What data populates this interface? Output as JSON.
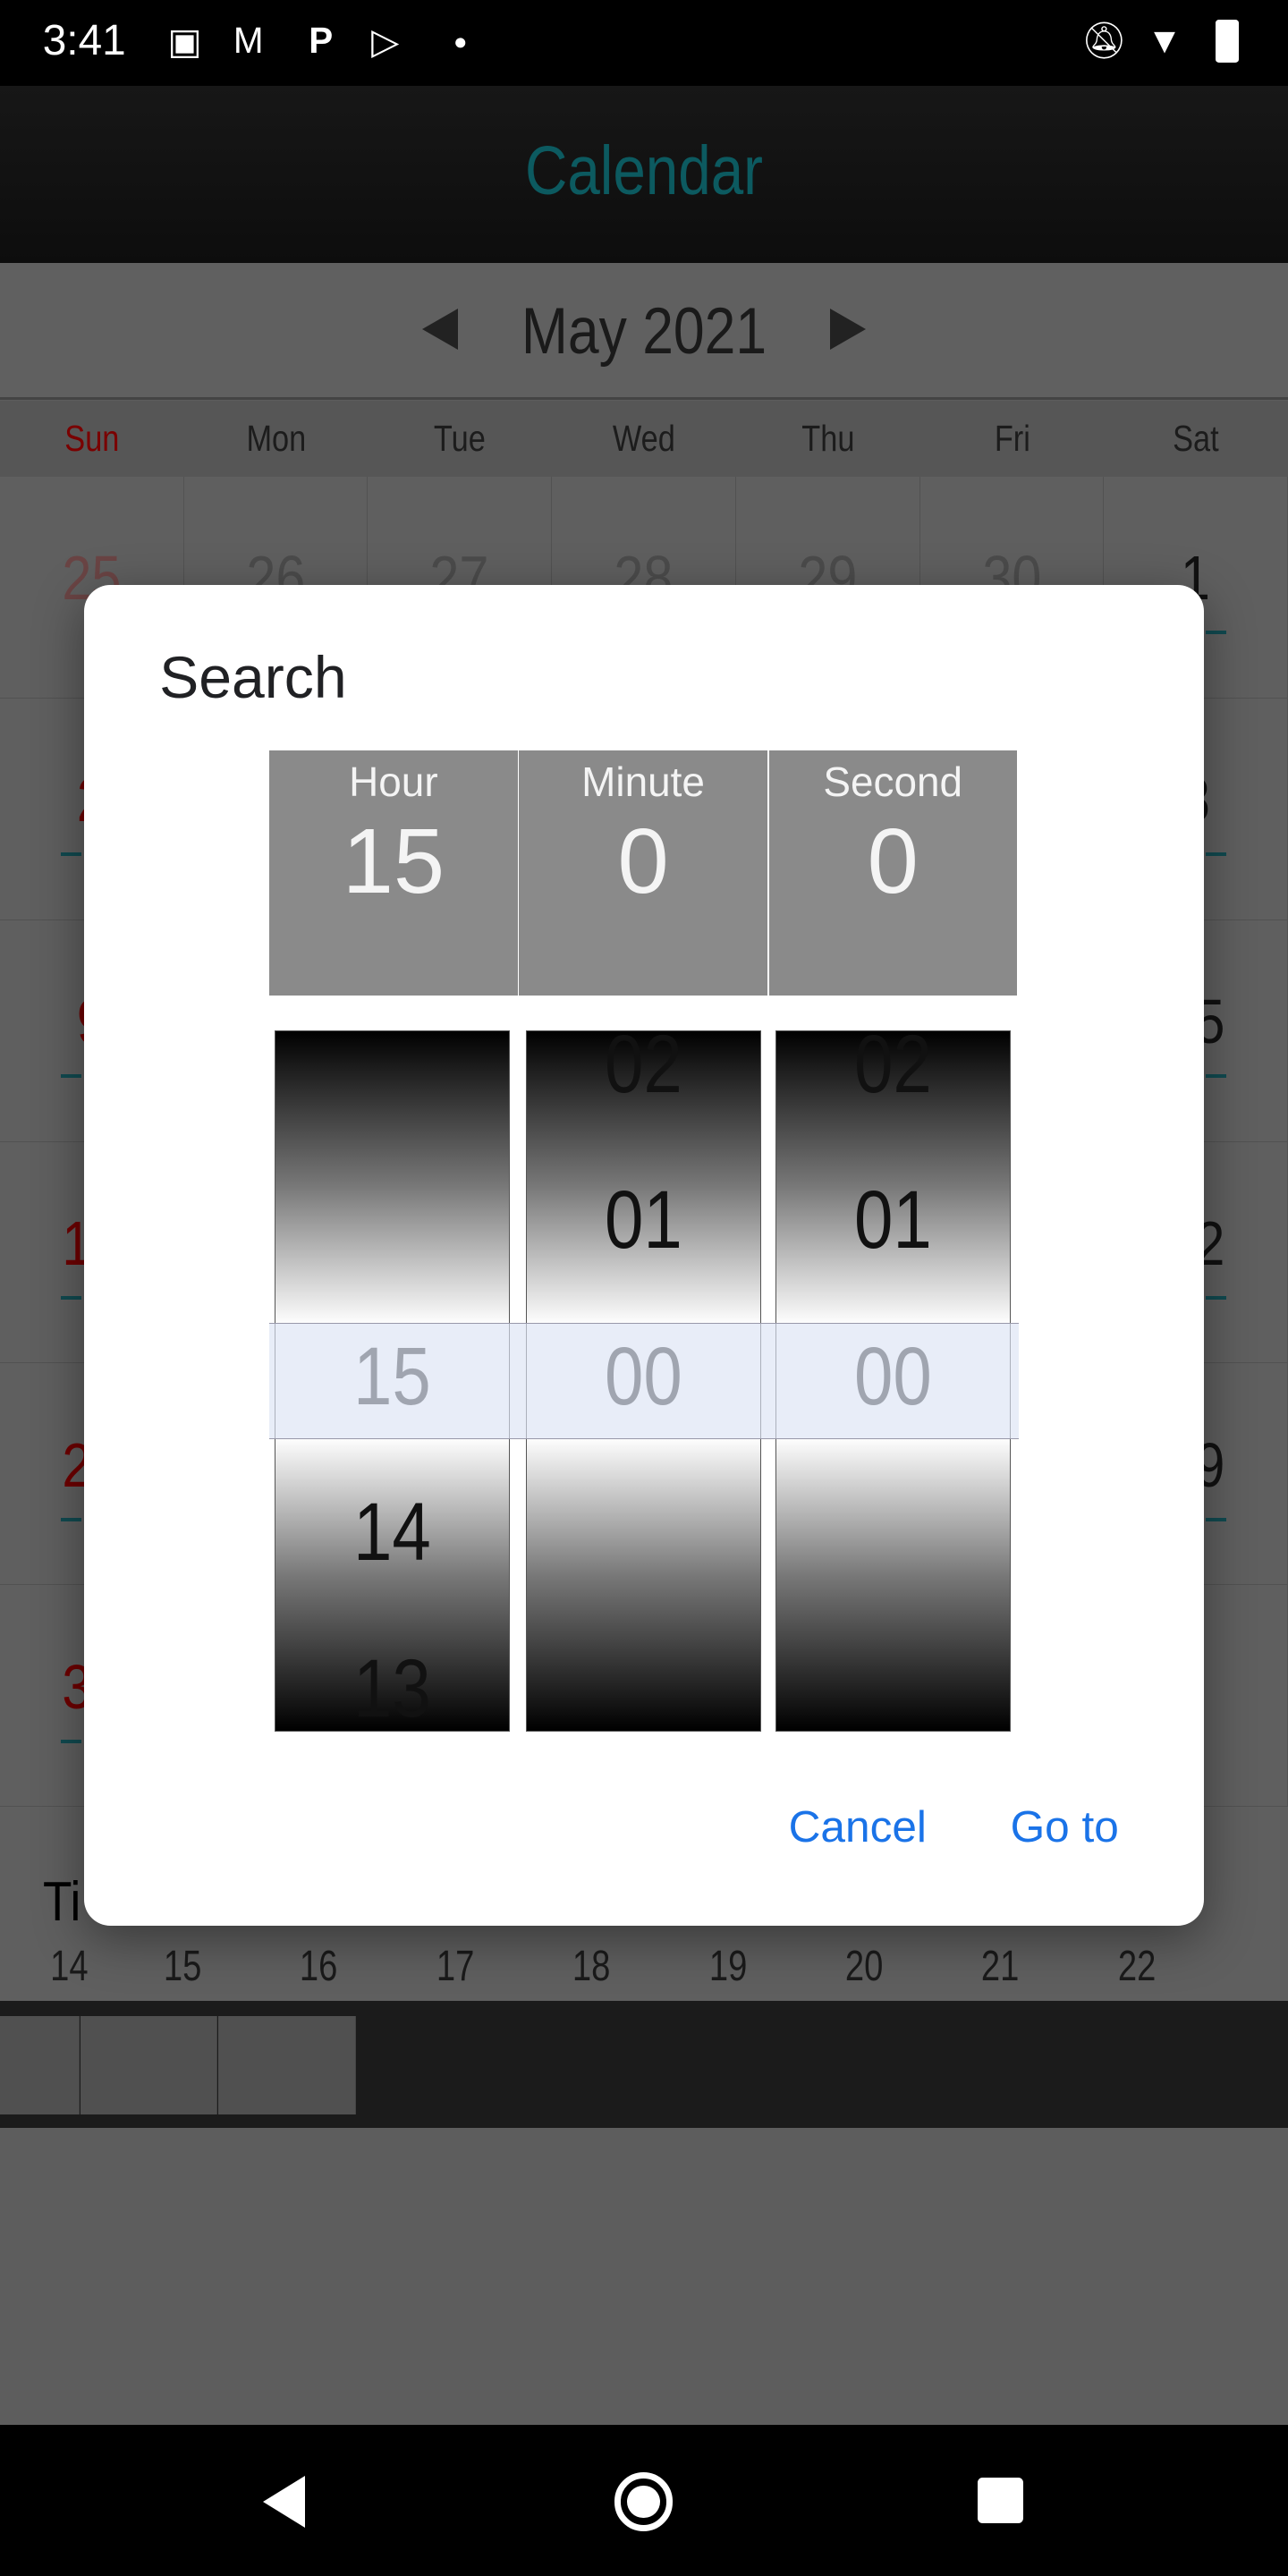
{
  "status_bar": {
    "time": "3:41",
    "icons": [
      "image-icon",
      "gmail-icon",
      "p-app-icon",
      "play-store-icon",
      "dot-icon",
      "notifications-off-icon",
      "wifi-icon",
      "battery-charging-icon"
    ]
  },
  "app_bar": {
    "title": "Calendar",
    "title_color": "#1a9aa3"
  },
  "month_nav": {
    "label": "May 2021",
    "prev": "prev-month",
    "next": "next-month"
  },
  "weekdays": [
    "Sun",
    "Mon",
    "Tue",
    "Wed",
    "Thu",
    "Fri",
    "Sat"
  ],
  "grid": [
    [
      "25",
      "26",
      "27",
      "28",
      "29",
      "30",
      "1"
    ],
    [
      "2",
      "",
      "",
      "",
      "",
      "",
      "8"
    ],
    [
      "9",
      "",
      "",
      "",
      "",
      "",
      "15"
    ],
    [
      "16",
      "",
      "",
      "",
      "",
      "",
      "22"
    ],
    [
      "23",
      "",
      "",
      "",
      "",
      "",
      "29"
    ],
    [
      "30",
      "",
      "",
      "",
      "",
      "",
      ""
    ]
  ],
  "timeline": {
    "label_partial": "Ti",
    "hours": [
      "14",
      "15",
      "16",
      "17",
      "18",
      "19",
      "20",
      "21",
      "22"
    ]
  },
  "dialog": {
    "title": "Search",
    "columns": [
      {
        "label": "Hour",
        "value": "15",
        "wheel": [
          "",
          "",
          "15",
          "14",
          "13"
        ]
      },
      {
        "label": "Minute",
        "value": "0",
        "wheel": [
          "02",
          "01",
          "00",
          "",
          ""
        ]
      },
      {
        "label": "Second",
        "value": "0",
        "wheel": [
          "02",
          "01",
          "00",
          "",
          ""
        ]
      }
    ],
    "cancel_label": "Cancel",
    "confirm_label": "Go to",
    "accent": "#1a73e8"
  }
}
